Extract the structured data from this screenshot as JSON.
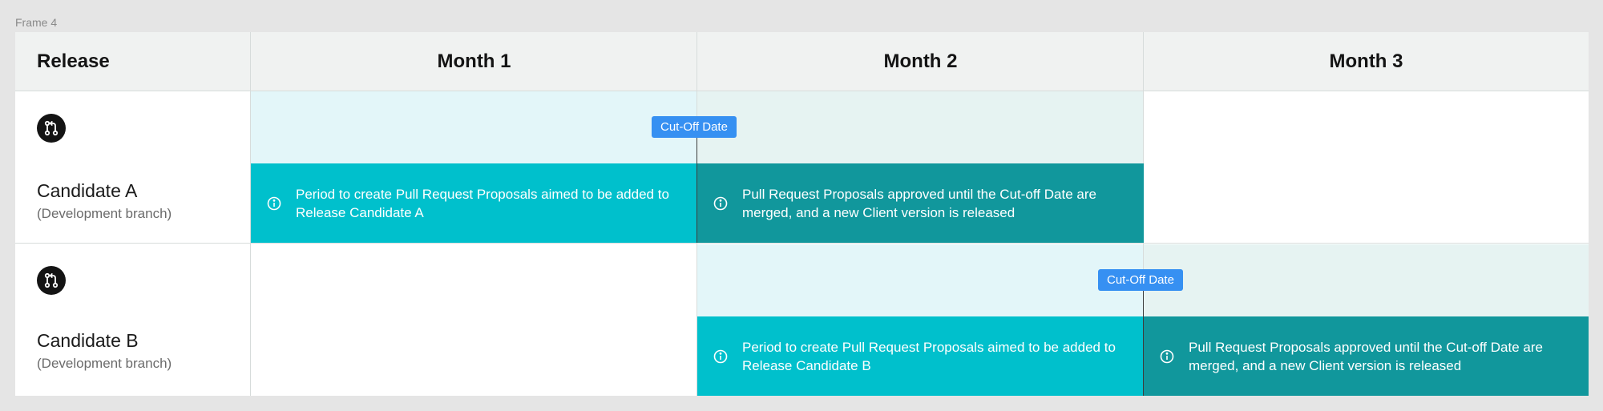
{
  "frame_label": "Frame 4",
  "header": {
    "release": "Release",
    "months": [
      "Month 1",
      "Month 2",
      "Month 3"
    ]
  },
  "rows": [
    {
      "title": "Candidate A",
      "subtitle": "(Development branch)",
      "icon": "git-pull-request-icon",
      "cutoff_label": "Cut-Off Date",
      "create_period_text": "Period to create Pull Request Proposals aimed to be added to Release Candidate A",
      "release_period_text": "Pull Request Proposals approved until the Cut-off Date are merged, and a new Client version is released"
    },
    {
      "title": "Candidate B",
      "subtitle": "(Development branch)",
      "icon": "git-pull-request-icon",
      "cutoff_label": "Cut-Off Date",
      "create_period_text": "Period to create Pull Request Proposals aimed to be added to Release Candidate B",
      "release_period_text": "Pull Request Proposals approved until the Cut-off Date are merged, and a new Client version is released"
    }
  ],
  "colors": {
    "create_period": "#00c0cc",
    "release_period": "#11979c",
    "cutoff_tag": "#3690f2",
    "pre_cutoff_band": "#e3f6f9",
    "post_cutoff_band": "#e6f3f2"
  }
}
